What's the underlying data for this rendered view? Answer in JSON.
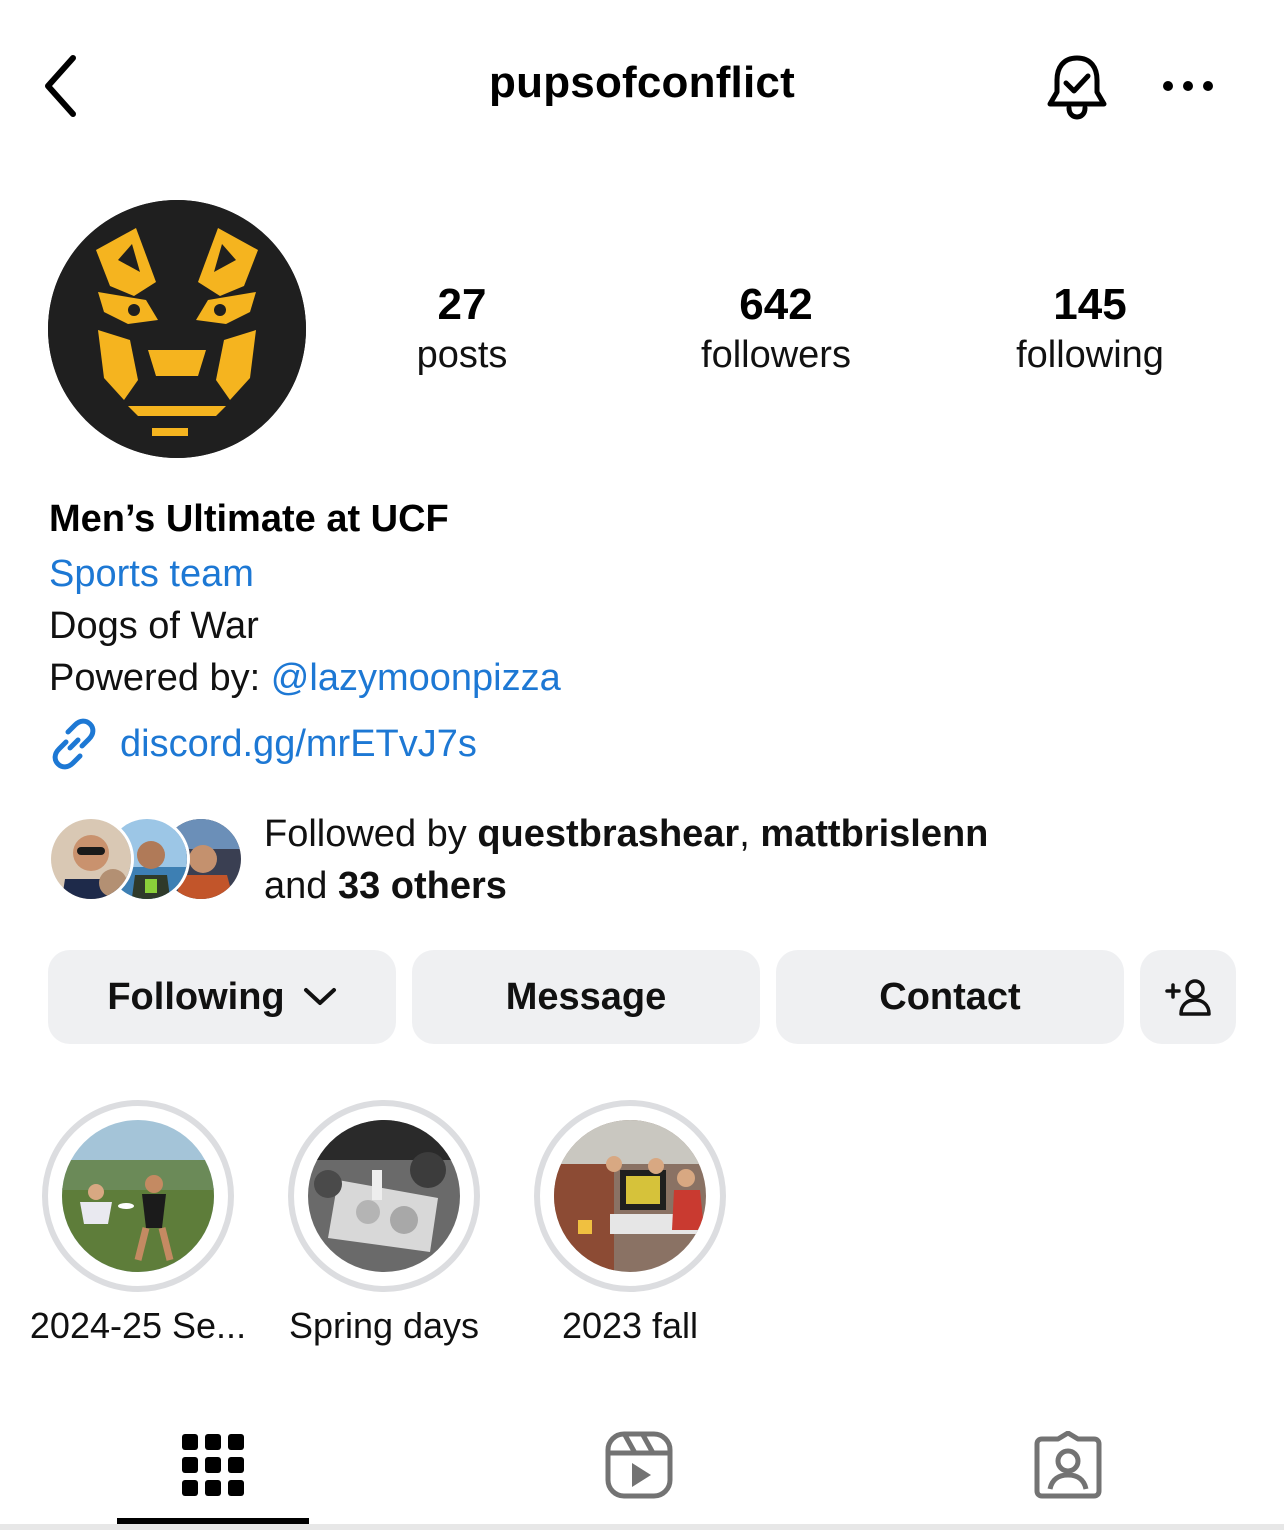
{
  "header": {
    "username": "pupsofconflict",
    "back_icon": "chevron-left-icon",
    "notification_icon": "bell-check-icon",
    "more_icon": "more-horizontal-icon"
  },
  "stats": {
    "posts_count": "27",
    "posts_label": "posts",
    "followers_count": "642",
    "followers_label": "followers",
    "following_count": "145",
    "following_label": "following"
  },
  "bio": {
    "name": "Men’s Ultimate at UCF",
    "category": "Sports team",
    "line1": "Dogs of War",
    "line2_prefix": "Powered by: ",
    "line2_mention": "@lazymoonpizza",
    "link": "discord.gg/mrETvJ7s"
  },
  "followed_by": {
    "prefix": "Followed by ",
    "user1": "questbrashear",
    "separator": ", ",
    "user2": "mattbrislenn",
    "line2_prefix": "and ",
    "others": "33 others"
  },
  "buttons": {
    "following": "Following",
    "message": "Message",
    "contact": "Contact"
  },
  "highlights": [
    {
      "label": "2024-25 Se..."
    },
    {
      "label": "Spring days"
    },
    {
      "label": "2023 fall"
    }
  ],
  "tabs": {
    "grid_icon": "grid-icon",
    "reels_icon": "reels-icon",
    "tagged_icon": "tagged-icon",
    "active": "grid"
  },
  "colors": {
    "link_blue": "#1d78d4",
    "button_bg": "#eff0f2",
    "logo_gold": "#f5b41f",
    "logo_bg": "#1f1f1f"
  }
}
